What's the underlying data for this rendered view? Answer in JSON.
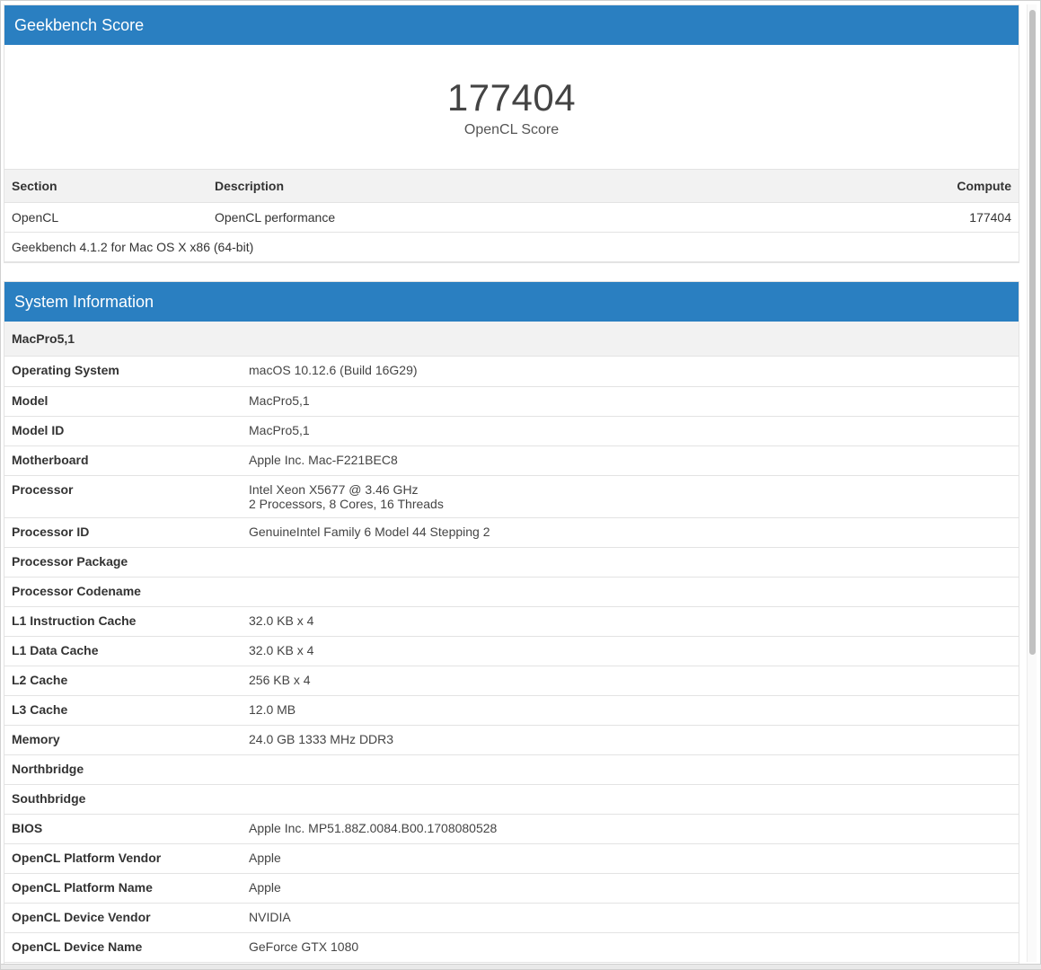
{
  "score_card": {
    "header_title": "Geekbench Score",
    "score_value": "177404",
    "score_label": "OpenCL Score",
    "table": {
      "headers": {
        "section": "Section",
        "description": "Description",
        "compute": "Compute"
      },
      "rows": [
        {
          "section": "OpenCL",
          "description": "OpenCL performance",
          "compute": "177404"
        }
      ],
      "footer": "Geekbench 4.1.2 for Mac OS X x86 (64-bit)"
    }
  },
  "system_info": {
    "header_title": "System Information",
    "subheader": "MacPro5,1",
    "rows": [
      {
        "key": "Operating System",
        "value": [
          "macOS 10.12.6 (Build 16G29)"
        ]
      },
      {
        "key": "Model",
        "value": [
          "MacPro5,1"
        ]
      },
      {
        "key": "Model ID",
        "value": [
          "MacPro5,1"
        ]
      },
      {
        "key": "Motherboard",
        "value": [
          "Apple Inc. Mac-F221BEC8"
        ]
      },
      {
        "key": "Processor",
        "value": [
          "Intel Xeon X5677 @ 3.46 GHz",
          "2 Processors, 8 Cores, 16 Threads"
        ]
      },
      {
        "key": "Processor ID",
        "value": [
          "GenuineIntel Family 6 Model 44 Stepping 2"
        ]
      },
      {
        "key": "Processor Package",
        "value": [
          ""
        ]
      },
      {
        "key": "Processor Codename",
        "value": [
          ""
        ]
      },
      {
        "key": "L1 Instruction Cache",
        "value": [
          "32.0 KB x 4"
        ]
      },
      {
        "key": "L1 Data Cache",
        "value": [
          "32.0 KB x 4"
        ]
      },
      {
        "key": "L2 Cache",
        "value": [
          "256 KB x 4"
        ]
      },
      {
        "key": "L3 Cache",
        "value": [
          "12.0 MB"
        ]
      },
      {
        "key": "Memory",
        "value": [
          "24.0 GB 1333 MHz DDR3"
        ]
      },
      {
        "key": "Northbridge",
        "value": [
          ""
        ]
      },
      {
        "key": "Southbridge",
        "value": [
          ""
        ]
      },
      {
        "key": "BIOS",
        "value": [
          "Apple Inc. MP51.88Z.0084.B00.1708080528"
        ]
      },
      {
        "key": "OpenCL Platform Vendor",
        "value": [
          "Apple"
        ]
      },
      {
        "key": "OpenCL Platform Name",
        "value": [
          "Apple"
        ]
      },
      {
        "key": "OpenCL Device Vendor",
        "value": [
          "NVIDIA"
        ]
      },
      {
        "key": "OpenCL Device Name",
        "value": [
          "GeForce GTX 1080"
        ]
      }
    ]
  },
  "colors": {
    "header_blue": "#2a7fc1",
    "row_gray": "#f2f2f2",
    "border": "#e3e3e3"
  }
}
